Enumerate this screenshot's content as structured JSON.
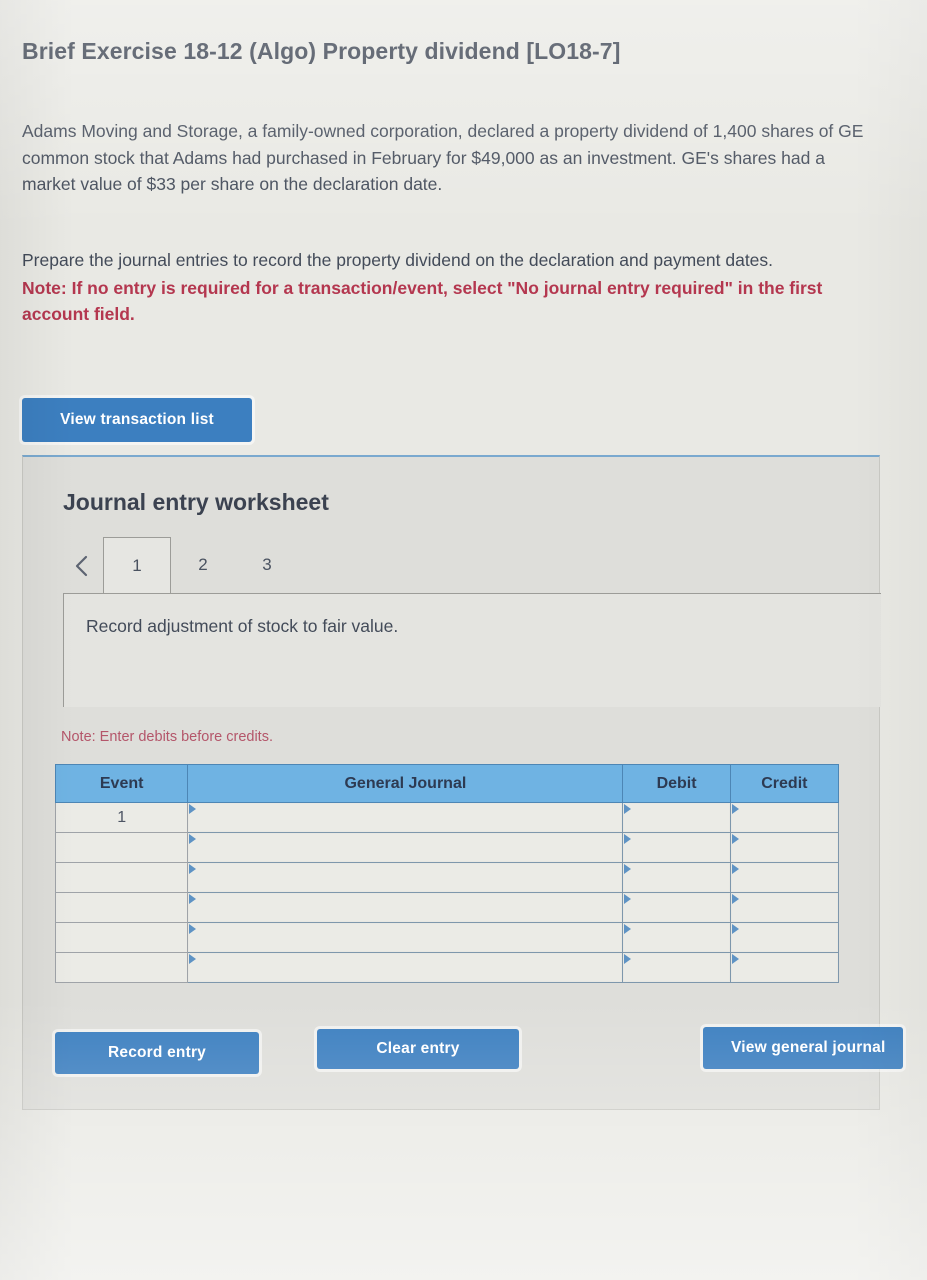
{
  "question": {
    "title": "Brief Exercise 18-12 (Algo) Property dividend [LO18-7]",
    "scenario": "Adams Moving and Storage, a family-owned corporation, declared a property dividend of 1,400 shares of GE common stock that Adams had purchased in February for $49,000 as an investment. GE's shares had a market value of $33 per share on the declaration date.",
    "instruction": "Prepare the journal entries to record the property dividend on the declaration and payment dates.",
    "note": "Note: If no entry is required for a transaction/event, select \"No journal entry required\" in the first account field."
  },
  "toolbar": {
    "view_transaction_list_label": "View transaction list"
  },
  "worksheet": {
    "title": "Journal entry worksheet",
    "prev_icon": "chevron-left-icon",
    "tabs": [
      {
        "label": "1",
        "active": true
      },
      {
        "label": "2",
        "active": false
      },
      {
        "label": "3",
        "active": false
      }
    ],
    "description": "Record adjustment of stock to fair value.",
    "debits_note": "Note: Enter debits before credits."
  },
  "table": {
    "headers": [
      "Event",
      "General Journal",
      "Debit",
      "Credit"
    ],
    "rows": [
      {
        "event": "1",
        "general_journal": "",
        "debit": "",
        "credit": ""
      },
      {
        "event": "",
        "general_journal": "",
        "debit": "",
        "credit": ""
      },
      {
        "event": "",
        "general_journal": "",
        "debit": "",
        "credit": ""
      },
      {
        "event": "",
        "general_journal": "",
        "debit": "",
        "credit": ""
      },
      {
        "event": "",
        "general_journal": "",
        "debit": "",
        "credit": ""
      },
      {
        "event": "",
        "general_journal": "",
        "debit": "",
        "credit": ""
      }
    ]
  },
  "footer": {
    "record_entry_label": "Record entry",
    "clear_entry_label": "Clear entry",
    "view_general_journal_label": "View general journal"
  },
  "colors": {
    "button_blue": "#3c7fc0",
    "table_header_blue": "#6fb3e3",
    "note_red": "#b4374f",
    "page_background": "#e9e9e4",
    "panel_background": "#dededa"
  }
}
